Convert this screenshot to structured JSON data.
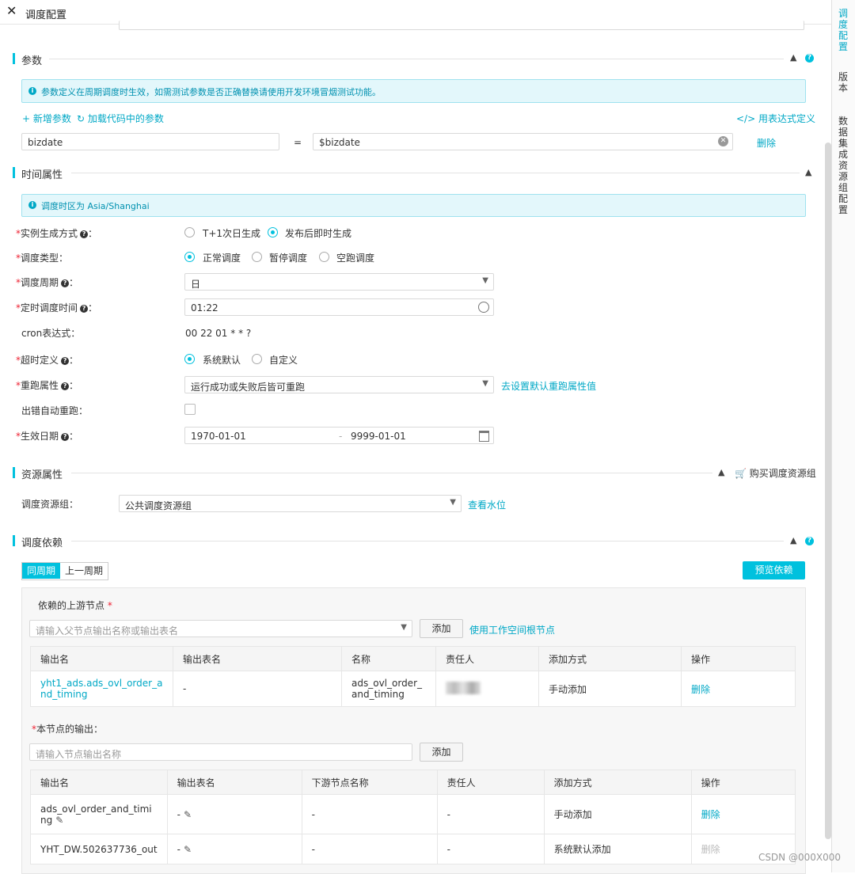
{
  "header": {
    "close_icon": "close-icon",
    "title": "调度配置"
  },
  "right_tabs": [
    {
      "label": "调度配置",
      "active": true
    },
    {
      "label": "版本",
      "active": false
    },
    {
      "label": "数据集成资源组配置",
      "active": false
    }
  ],
  "params": {
    "section_title": "参数",
    "info": "参数定义在周期调度时生效，如需测试参数是否正确替换请使用开发环境冒烟测试功能。",
    "add_param": "+ 新增参数",
    "load_params": "加载代码中的参数",
    "expr_define": "</> 用表达式定义",
    "name_value": "bizdate",
    "equals": "=",
    "value_value": "$bizdate",
    "delete": "删除"
  },
  "time": {
    "section_title": "时间属性",
    "info": "调度时区为 Asia/Shanghai",
    "instance_label": "实例生成方式",
    "instance_opt1": "T+1次日生成",
    "instance_opt2": "发布后即时生成",
    "type_label": "调度类型",
    "type_opt1": "正常调度",
    "type_opt2": "暂停调度",
    "type_opt3": "空跑调度",
    "cycle_label": "调度周期",
    "cycle_value": "日",
    "timed_label": "定时调度时间",
    "timed_value": "01:22",
    "cron_label": "cron表达式",
    "cron_value": "00 22 01 * * ?",
    "timeout_label": "超时定义",
    "timeout_opt1": "系统默认",
    "timeout_opt2": "自定义",
    "rerun_label": "重跑属性",
    "rerun_value": "运行成功或失败后皆可重跑",
    "rerun_link": "去设置默认重跑属性值",
    "auto_rerun_label": "出错自动重跑",
    "effective_label": "生效日期",
    "effective_start": "1970-01-01",
    "effective_sep": "-",
    "effective_end": "9999-01-01",
    "colon": "："
  },
  "resource": {
    "section_title": "资源属性",
    "buy_link": "购买调度资源组",
    "group_label": "调度资源组：",
    "group_value": "公共调度资源组",
    "watermark_link": "查看水位"
  },
  "deps": {
    "section_title": "调度依赖",
    "tab_same": "同周期",
    "tab_prev": "上一周期",
    "preview_btn": "预览依赖",
    "upstream_title": "依赖的上游节点",
    "upstream_placeholder": "请输入父节点输出名称或输出表名",
    "add_btn": "添加",
    "use_root": "使用工作空间根节点",
    "upstream_headers": [
      "输出名",
      "输出表名",
      "名称",
      "责任人",
      "添加方式",
      "操作"
    ],
    "upstream_rows": [
      {
        "out_name": "yht1_ads.ads_ovl_order_and_timing",
        "out_table": "-",
        "name": "ads_ovl_order_and_timing",
        "add_mode": "手动添加",
        "op": "删除"
      }
    ],
    "output_title": "本节点的输出：",
    "output_placeholder": "请输入节点输出名称",
    "output_headers": [
      "输出名",
      "输出表名",
      "下游节点名称",
      "责任人",
      "添加方式",
      "操作"
    ],
    "output_rows": [
      {
        "out_name": "ads_ovl_order_and_timing",
        "out_table": "-",
        "down": "-",
        "owner": "-",
        "add_mode": "手动添加",
        "op": "删除"
      },
      {
        "out_name": "YHT_DW.502637736_out",
        "out_table": "-",
        "down": "-",
        "owner": "-",
        "add_mode": "系统默认添加",
        "op": "删除"
      }
    ]
  },
  "watermark": "CSDN @000X000",
  "colors": {
    "accent": "#00c1de",
    "link": "#00a8c6",
    "info_bg": "#e3f7fb"
  }
}
